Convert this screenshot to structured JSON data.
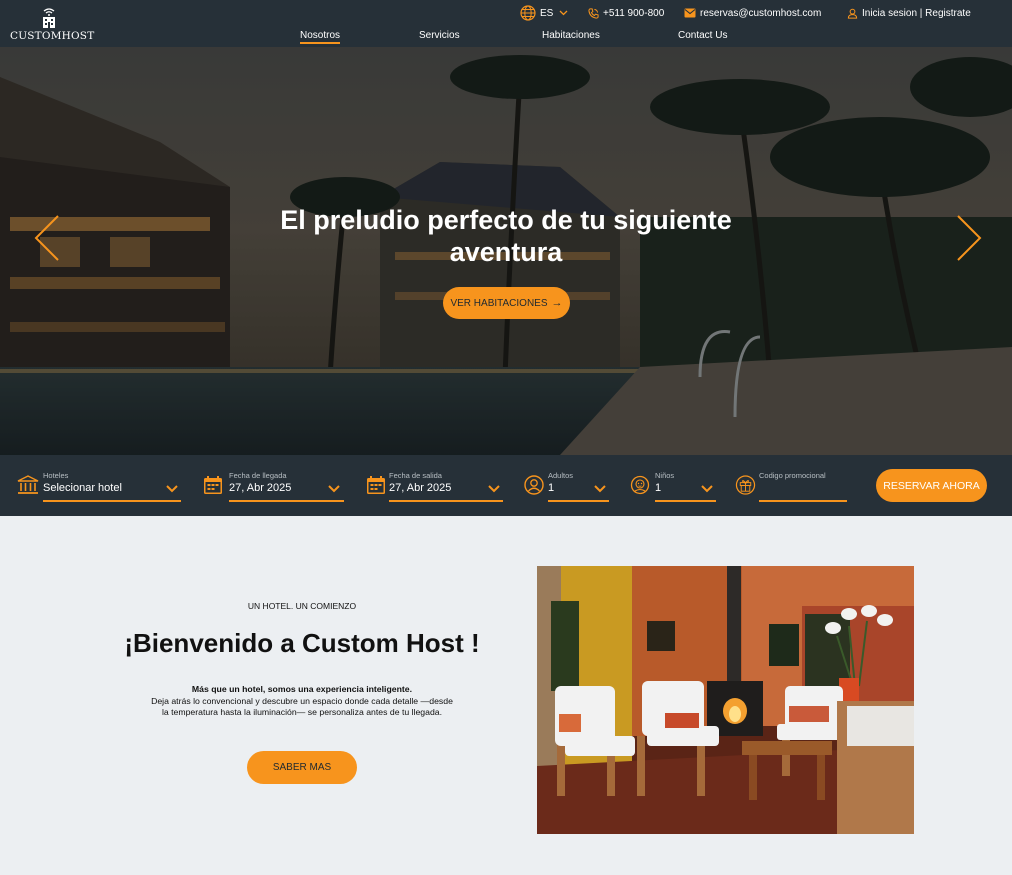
{
  "brand": {
    "name": "CUSTOMHOST"
  },
  "topbar": {
    "language": "ES",
    "phone": "+511 900-800",
    "email": "reservas@customhost.com",
    "login": "Inicia sesion | Registrate"
  },
  "nav": {
    "items": [
      {
        "label": "Nosotros",
        "active": true
      },
      {
        "label": "Servicios",
        "active": false
      },
      {
        "label": "Habitaciones",
        "active": false
      },
      {
        "label": "Contact Us",
        "active": false
      }
    ]
  },
  "hero": {
    "title_line1": "El preludio perfecto de tu siguiente",
    "title_line2": "aventura",
    "button": "VER HABITACIONES",
    "button_icon": "arrow-right-icon"
  },
  "booking": {
    "hotel": {
      "label": "Hoteles",
      "value": "Selecionar hotel",
      "icon": "bank-icon"
    },
    "arrival": {
      "label": "Fecha de llegada",
      "value": "27, Abr 2025",
      "icon": "calendar-icon"
    },
    "departure": {
      "label": "Fecha de salida",
      "value": "27, Abr 2025",
      "icon": "calendar-icon"
    },
    "adults": {
      "label": "Adultos",
      "value": "1",
      "icon": "user-icon"
    },
    "children": {
      "label": "Niños",
      "value": "1",
      "icon": "child-icon"
    },
    "promo": {
      "label": "Codigo promocional",
      "value": "",
      "icon": "gift-icon"
    },
    "submit": "RESERVAR AHORA"
  },
  "welcome": {
    "eyebrow": "UN HOTEL. UN COMIENZO",
    "title": "¡Bienvenido a Custom Host !",
    "desc_line1": "Más que un hotel, somos una experiencia inteligente.",
    "desc_line2": "Deja atrás lo convencional y descubre un espacio donde cada detalle —desde",
    "desc_line3": "la temperatura hasta la iluminación— se personaliza antes de tu llegada.",
    "button": "SABER MAS"
  },
  "colors": {
    "accent": "#f7941d",
    "header_bg": "#263038",
    "section_bg": "#eceff2"
  }
}
